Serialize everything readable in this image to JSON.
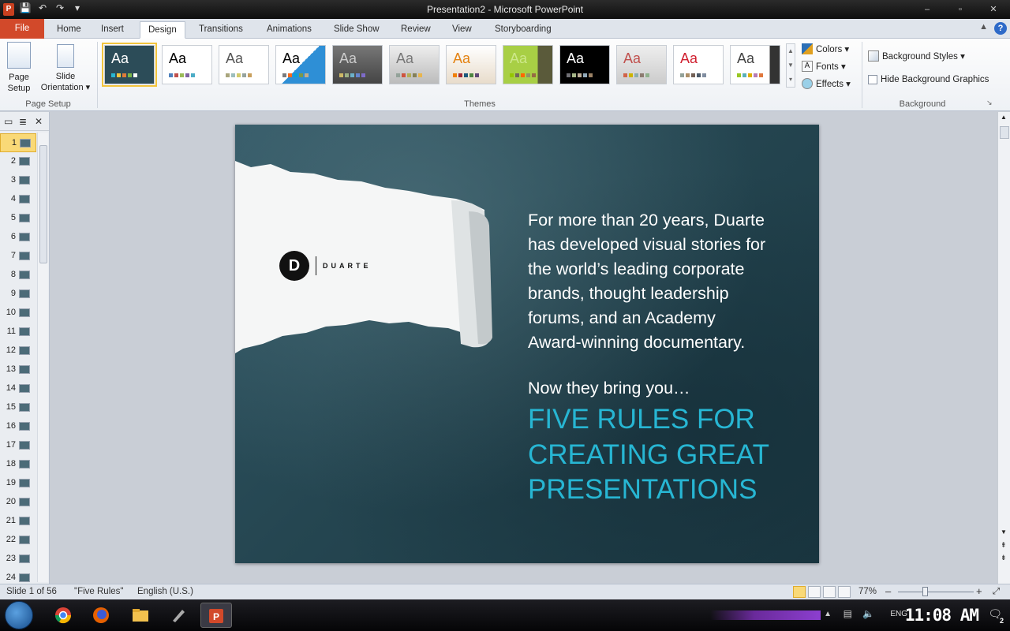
{
  "window": {
    "title": "Presentation2 - Microsoft PowerPoint",
    "app_badge": "P",
    "minimize_label": "–",
    "restore_label": "▫",
    "close_label": "✕"
  },
  "tabs": {
    "file": "File",
    "items": [
      "Home",
      "Insert",
      "Design",
      "Transitions",
      "Animations",
      "Slide Show",
      "Review",
      "View",
      "Storyboarding"
    ],
    "active": "Design"
  },
  "ribbon": {
    "page_setup": {
      "page_setup_label_1": "Page",
      "page_setup_label_2": "Setup",
      "orientation_label_1": "Slide",
      "orientation_label_2": "Orientation ▾",
      "group_label": "Page Setup"
    },
    "themes": {
      "group_label": "Themes",
      "sample_text": "Aa"
    },
    "theme_options": {
      "colors": "Colors ▾",
      "fonts": "Fonts ▾",
      "effects": "Effects ▾"
    },
    "background": {
      "styles": "Background Styles ▾",
      "hide_graphics": "Hide Background Graphics",
      "group_label": "Background"
    }
  },
  "slides_panel": {
    "numbers": [
      "1",
      "2",
      "3",
      "4",
      "5",
      "6",
      "7",
      "8",
      "9",
      "10",
      "11",
      "12",
      "13",
      "14",
      "15",
      "16",
      "17",
      "18",
      "19",
      "20",
      "21",
      "22",
      "23",
      "24"
    ],
    "selected": "1"
  },
  "slide": {
    "logo_mark": "D",
    "logo_word": "DUARTE",
    "body_lines": [
      "For more than 20 years, Duarte",
      "has developed visual stories for",
      "the world’s leading corporate",
      "brands, thought leadership",
      "forums, and an Academy",
      "Award-winning documentary."
    ],
    "intro": "Now they bring you…",
    "headline_lines": [
      "FIVE RULES FOR",
      "CREATING GREAT",
      "PRESENTATIONS"
    ],
    "headline_color": "#27b6d3"
  },
  "statusbar": {
    "slide_info": "Slide 1 of 56",
    "theme_name": "\"Five Rules\"",
    "language": "English (U.S.)",
    "zoom": "77%",
    "zoom_out": "–",
    "zoom_in": "+"
  },
  "taskbar": {
    "lang": "ENG",
    "time": "11:08 AM",
    "notif_count": "2"
  },
  "colors": {
    "file_tab": "#d2492a",
    "slide_bg": "#254651",
    "selection": "#f9d977"
  }
}
